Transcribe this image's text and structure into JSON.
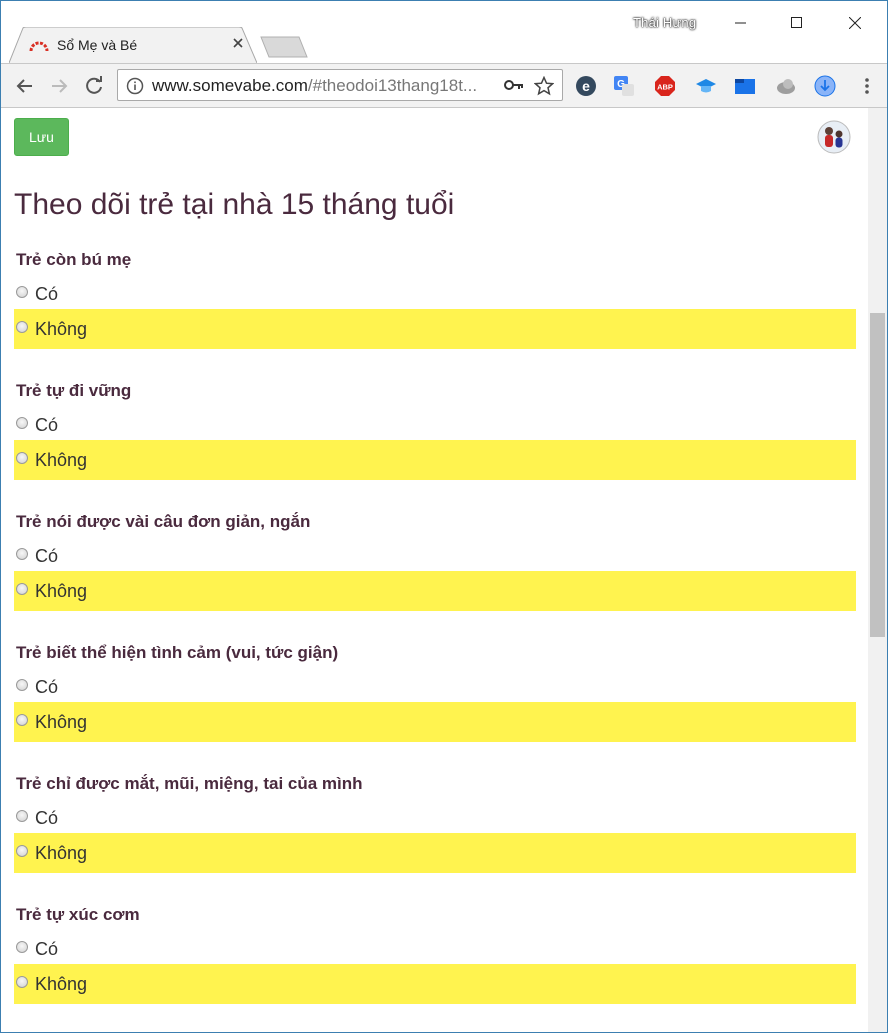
{
  "browser": {
    "tab_title": "Sổ Mẹ và Bé",
    "profile_name": "Thái Hưng",
    "url_host": "www.somevabe.com",
    "url_path": "/#theodoi13thang18t..."
  },
  "page": {
    "save_label": "Lưu",
    "title": "Theo dõi trẻ tại nhà 15 tháng tuổi",
    "questions": [
      {
        "label": "Trẻ còn bú mẹ",
        "yes": "Có",
        "no": "Không"
      },
      {
        "label": "Trẻ tự đi vững",
        "yes": "Có",
        "no": "Không"
      },
      {
        "label": "Trẻ nói được vài câu đơn giản, ngắn",
        "yes": "Có",
        "no": "Không"
      },
      {
        "label": "Trẻ biết thể hiện tình cảm (vui, tức giận)",
        "yes": "Có",
        "no": "Không"
      },
      {
        "label": "Trẻ chỉ được mắt, mũi, miệng, tai của mình",
        "yes": "Có",
        "no": "Không"
      },
      {
        "label": "Trẻ tự xúc cơm",
        "yes": "Có",
        "no": "Không"
      }
    ]
  },
  "colors": {
    "highlight": "#fff34f",
    "save_button": "#5cb85c",
    "heading_text": "#4a2a3e"
  },
  "icons": [
    "somevabe-favicon",
    "close-icon",
    "minimize-icon",
    "maximize-icon",
    "back-icon",
    "forward-icon",
    "reload-icon",
    "info-icon",
    "key-icon",
    "star-icon",
    "edge-extension-icon",
    "translate-icon",
    "adblock-plus-icon",
    "graduation-cap-icon",
    "tab-extension-icon",
    "cloud-extension-icon",
    "download-icon",
    "menu-icon"
  ]
}
